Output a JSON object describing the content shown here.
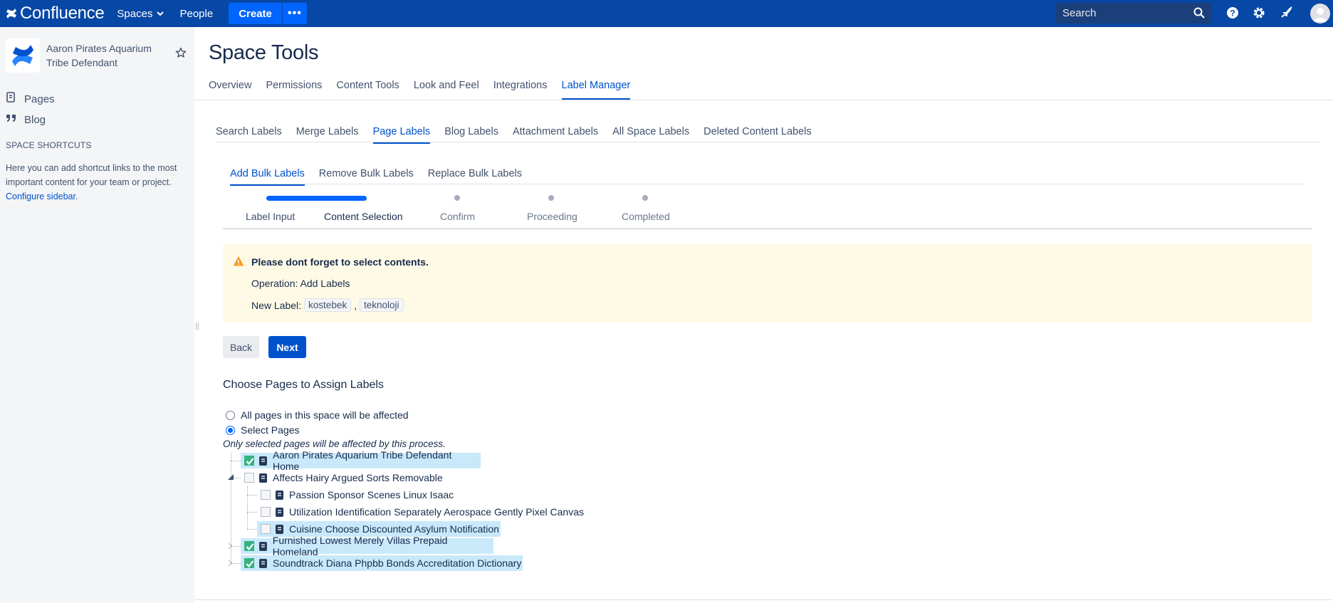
{
  "topbar": {
    "logo_text": "Confluence",
    "spaces_label": "Spaces",
    "people_label": "People",
    "create_label": "Create",
    "more_label": "•••",
    "search_placeholder": "Search",
    "icons": [
      "help-icon",
      "settings-icon",
      "notifications-icon",
      "avatar"
    ]
  },
  "sidebar": {
    "space_name": "Aaron Pirates Aquarium Tribe Defendant",
    "links": [
      {
        "label": "Pages",
        "icon": "pages-icon"
      },
      {
        "label": "Blog",
        "icon": "blog-quote-icon"
      }
    ],
    "shortcuts_title": "SPACE SHORTCUTS",
    "shortcuts_text": "Here you can add shortcut links to the most important content for your team or project.",
    "configure_link": "Configure sidebar",
    "configure_suffix": "."
  },
  "main": {
    "title": "Space Tools",
    "tabs": [
      {
        "label": "Overview",
        "active": false
      },
      {
        "label": "Permissions",
        "active": false
      },
      {
        "label": "Content Tools",
        "active": false
      },
      {
        "label": "Look and Feel",
        "active": false
      },
      {
        "label": "Integrations",
        "active": false
      },
      {
        "label": "Label Manager",
        "active": true
      }
    ],
    "label_tabs": [
      {
        "label": "Search Labels",
        "active": false
      },
      {
        "label": "Merge Labels",
        "active": false
      },
      {
        "label": "Page Labels",
        "active": true
      },
      {
        "label": "Blog Labels",
        "active": false
      },
      {
        "label": "Attachment Labels",
        "active": false
      },
      {
        "label": "All Space Labels",
        "active": false
      },
      {
        "label": "Deleted Content Labels",
        "active": false
      }
    ],
    "bulk_tabs": [
      {
        "label": "Add Bulk Labels",
        "active": true
      },
      {
        "label": "Remove Bulk Labels",
        "active": false
      },
      {
        "label": "Replace Bulk Labels",
        "active": false
      }
    ],
    "steps": [
      {
        "label": "Label Input",
        "state": "done"
      },
      {
        "label": "Content Selection",
        "state": "current"
      },
      {
        "label": "Confirm",
        "state": "pending"
      },
      {
        "label": "Proceeding",
        "state": "pending"
      },
      {
        "label": "Completed",
        "state": "pending"
      }
    ],
    "warning": {
      "title": "Please dont forget to select contents.",
      "operation": "Operation: Add Labels",
      "new_label_prefix": "New Label:",
      "labels": [
        "kostebek",
        "teknoloji"
      ],
      "separator": ","
    },
    "back_label": "Back",
    "next_label": "Next",
    "choose_title": "Choose Pages to Assign Labels",
    "radio_all": "All pages in this space will be affected",
    "radio_select": "Select Pages",
    "selected_radio": "Select Pages",
    "hint": "Only selected pages will be affected by this process.",
    "tree": [
      {
        "label": "Aaron Pirates Aquarium Tribe Defendant Home",
        "checked": true,
        "level": 0
      },
      {
        "label": "Affects Hairy Argued Sorts Removable",
        "checked": false,
        "level": 0,
        "expanded": true
      },
      {
        "label": "Passion Sponsor Scenes Linux Isaac",
        "checked": false,
        "level": 1
      },
      {
        "label": "Utilization Identification Separately Aerospace Gently Pixel Canvas",
        "checked": false,
        "level": 1
      },
      {
        "label": "Cuisine Choose Discounted Asylum Notification",
        "checked": false,
        "level": 1,
        "highlighted": true
      },
      {
        "label": "Furnished Lowest Merely Villas Prepaid Homeland",
        "checked": true,
        "level": 0
      },
      {
        "label": "Soundtrack Diana Phpbb Bonds Accreditation Dictionary",
        "checked": true,
        "level": 0
      }
    ]
  }
}
